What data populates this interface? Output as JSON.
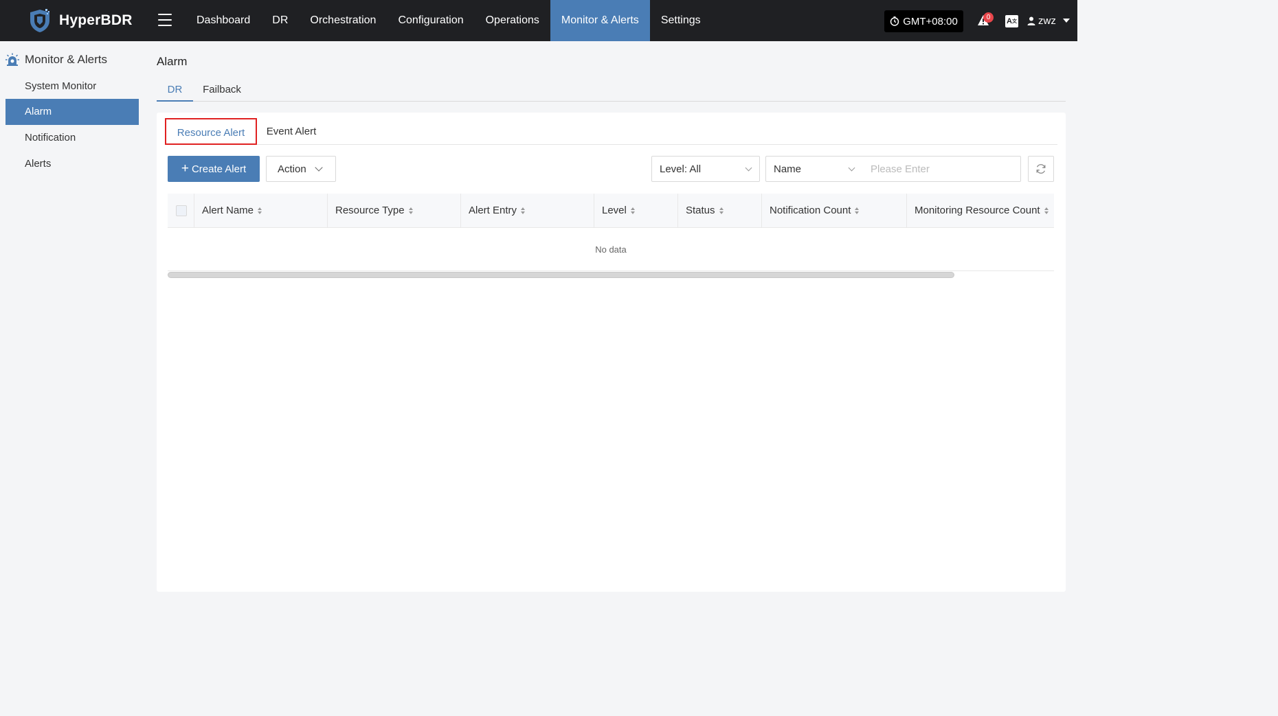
{
  "app": {
    "name": "HyperBDR"
  },
  "topnav": {
    "items": [
      {
        "label": "Dashboard",
        "active": false
      },
      {
        "label": "DR",
        "active": false
      },
      {
        "label": "Orchestration",
        "active": false
      },
      {
        "label": "Configuration",
        "active": false
      },
      {
        "label": "Operations",
        "active": false
      },
      {
        "label": "Monitor & Alerts",
        "active": true
      },
      {
        "label": "Settings",
        "active": false
      }
    ],
    "timezone": "GMT+08:00",
    "alert_count": "0",
    "language_icon": "translate-icon",
    "user": "zwz"
  },
  "sidebar": {
    "title": "Monitor & Alerts",
    "items": [
      {
        "label": "System Monitor",
        "active": false
      },
      {
        "label": "Alarm",
        "active": true
      },
      {
        "label": "Notification",
        "active": false
      },
      {
        "label": "Alerts",
        "active": false
      }
    ]
  },
  "main": {
    "title": "Alarm",
    "tabs": [
      {
        "label": "DR",
        "active": true
      },
      {
        "label": "Failback",
        "active": false
      }
    ],
    "subtabs": [
      {
        "label": "Resource Alert",
        "active": true
      },
      {
        "label": "Event Alert",
        "active": false
      }
    ],
    "toolbar": {
      "create_label": "Create Alert",
      "action_label": "Action",
      "level_filter": "Level: All",
      "search_field": "Name",
      "search_placeholder": "Please Enter",
      "search_value": ""
    },
    "table": {
      "columns": [
        "Alert Name",
        "Resource Type",
        "Alert Entry",
        "Level",
        "Status",
        "Notification Count",
        "Monitoring Resource Count"
      ],
      "rows": [],
      "empty_text": "No data"
    }
  },
  "colors": {
    "topbar": "#1f2023",
    "accent": "#4a7db5",
    "highlight_border": "#e02020",
    "badge": "#e8464b"
  }
}
